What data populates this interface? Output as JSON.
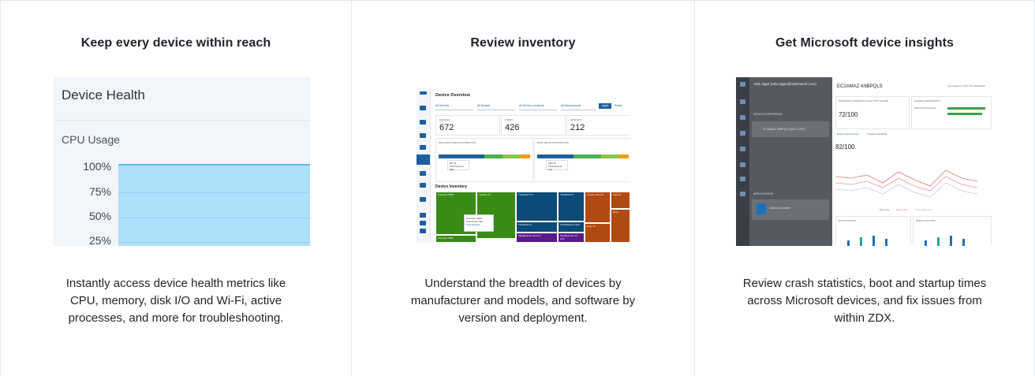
{
  "cards": [
    {
      "title": "Keep every device within reach",
      "description": "Instantly access device health metrics like CPU, memory, disk I/O and Wi-Fi, active processes, and more for troubleshooting."
    },
    {
      "title": "Review inventory",
      "description": "Understand the breadth of devices by manufacturer and models, and software by version and deployment."
    },
    {
      "title": "Get Microsoft device insights",
      "description": "Review crash statistics, boot and startup times across Microsoft devices, and fix issues from within ZDX."
    }
  ],
  "device_health": {
    "title": "Device Health",
    "metric_label": "CPU Usage",
    "ticks": [
      "100%",
      "75%",
      "50%",
      "25%"
    ],
    "area_color": "#aee0fb",
    "line_color": "#58b9ea"
  },
  "inventory": {
    "header": "Device Overview",
    "filters": [
      "All Devices",
      "All Models",
      "All Device Locations",
      "All Deployments"
    ],
    "apply_label": "Apply",
    "reset_label": "Reset",
    "stats": [
      {
        "label": "DEVICES",
        "value": "672"
      },
      {
        "label": "USERS",
        "value": "426"
      },
      {
        "label": "VENDORS",
        "value": "212"
      }
    ],
    "dist_labels": [
      "MANUFACTURER DISTRIBUTION",
      "DISK SPACE DISTRIBUTION"
    ],
    "tooltips": [
      {
        "line1": "HP 56",
        "line2": "Total Devices 300"
      },
      {
        "line1": "Intel 56",
        "line2": "Total Devices 234"
      }
    ],
    "inventory_header": "Device Inventory",
    "popup": {
      "line1": "Precision 3560",
      "line2": "Total Users 430",
      "line3": "Total Devices"
    },
    "tiles": [
      {
        "label": "Precision 3560",
        "color": "#3a8a16"
      },
      {
        "label": "Latitude 72",
        "color": "#3a8a16"
      },
      {
        "label": "ThinkPad T14",
        "color": "#0c4a78"
      },
      {
        "label": "ThinkPad P1",
        "color": "#0c4a78"
      },
      {
        "label": "Pavilion 15 inch",
        "color": "#b04a12"
      },
      {
        "label": "Spectre",
        "color": "#b04a12"
      },
      {
        "label": "Envy",
        "color": "#b04a12"
      },
      {
        "label": "ThinkPad X1",
        "color": "#0c4a78"
      },
      {
        "label": "ThinkStation P720",
        "color": "#0c4a78"
      },
      {
        "label": "Envy 17",
        "color": "#b04a12"
      },
      {
        "label": "Precision 3551",
        "color": "#3a8a16"
      },
      {
        "label": "MacBook Pro 16 inch",
        "color": "#5a1a8a"
      },
      {
        "label": "MacBook Pro 13 inch",
        "color": "#5a1a8a"
      }
    ]
  },
  "ms_insights": {
    "user": "Arlie Algar (arlie.algar@safemarch.com)",
    "device": "EC2AMAZ-K6BPQLS",
    "last_updated": "Last Updated: 12:57 PM 09/09/2024",
    "section_experience": "DEVICE EXPERIENCE",
    "device_row": "EC2AMAZ-K6BPQLS (DELL XPS)",
    "apps_label": "APPLICATIONS",
    "app_name": "Outlook Online",
    "score_label": "MICROSOFT ENDPOINT ANALYTICS SCORE",
    "score": "72/100",
    "score_components": "SCORE COMPONENTS",
    "startup_label": "Startup Performance",
    "tabs": [
      "Startup Performance",
      "Software Reliability"
    ],
    "startup_score": "82/100",
    "legend": [
      "Boot time",
      "Sign-in time",
      "Total startup time"
    ],
    "boot_history": "BOOT HISTORY",
    "signin_history": "SIGN-IN HISTORY",
    "bar_color": "#1f6fb6",
    "accent": "#3aa14a"
  }
}
